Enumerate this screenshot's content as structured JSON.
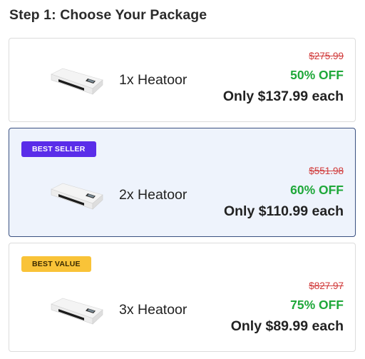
{
  "step_title": "Step 1: Choose Your Package",
  "colors": {
    "badge_best_seller": "#5a2de9",
    "badge_best_value": "#f9c338",
    "discount": "#1fa83a",
    "original_price": "#d13b3b",
    "selected_border": "#3b5181",
    "selected_background": "#eef3fc"
  },
  "packages": [
    {
      "badge": "",
      "quantity_label": "1x Heatoor",
      "original_price": "$275.99",
      "discount": "50% OFF",
      "price_each": "Only $137.99 each",
      "selected": false,
      "image_icon": "laminator-product-icon"
    },
    {
      "badge": "BEST SELLER",
      "quantity_label": "2x Heatoor",
      "original_price": "$551.98",
      "discount": "60% OFF",
      "price_each": "Only $110.99 each",
      "selected": true,
      "image_icon": "laminator-product-icon"
    },
    {
      "badge": "BEST VALUE",
      "quantity_label": "3x Heatoor",
      "original_price": "$827.97",
      "discount": "75% OFF",
      "price_each": "Only $89.99 each",
      "selected": false,
      "image_icon": "laminator-product-icon"
    }
  ]
}
